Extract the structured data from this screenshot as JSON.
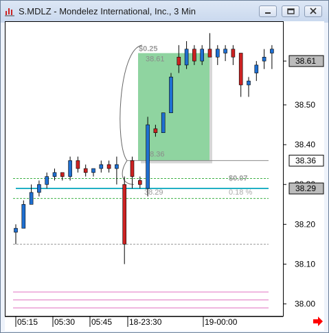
{
  "window": {
    "title": "S.MDLZ - Mondelez International, Inc., 3 Min",
    "icon": "chart-app-icon",
    "controls": [
      "minimize-icon",
      "maximize-icon",
      "close-icon"
    ]
  },
  "colors": {
    "up": "#1f6fd1",
    "down": "#cc2222",
    "hline_teal": "#20b0c4",
    "hline_green": "#3bb043",
    "hline_gray": "#999999",
    "hline_pink": "#e070c0",
    "box_fill": "#8fd4a0",
    "arrow": "#ff0000"
  },
  "chart_data": {
    "type": "candlestick",
    "ylim": [
      37.97,
      38.71
    ],
    "y_ticks": [
      "38.61",
      "38.50",
      "38.40",
      "38.30",
      "38.20",
      "38.10",
      "38.00"
    ],
    "price_labels": [
      {
        "text": "38.61",
        "value": 38.61,
        "style": "gray"
      },
      {
        "text": "38.36",
        "value": 38.36,
        "style": "white"
      },
      {
        "text": "38.29",
        "value": 38.29,
        "style": "gray"
      }
    ],
    "x_labels": [
      "05:15",
      "05:30",
      "05:45",
      "18-23:30",
      "19-00:00"
    ],
    "candles": [
      {
        "o": 38.18,
        "h": 38.2,
        "l": 38.15,
        "c": 38.19
      },
      {
        "o": 38.19,
        "h": 38.26,
        "l": 38.19,
        "c": 38.25
      },
      {
        "o": 38.25,
        "h": 38.3,
        "l": 38.25,
        "c": 38.28
      },
      {
        "o": 38.28,
        "h": 38.31,
        "l": 38.27,
        "c": 38.3
      },
      {
        "o": 38.3,
        "h": 38.33,
        "l": 38.29,
        "c": 38.32
      },
      {
        "o": 38.32,
        "h": 38.34,
        "l": 38.31,
        "c": 38.33
      },
      {
        "o": 38.33,
        "h": 38.33,
        "l": 38.31,
        "c": 38.32
      },
      {
        "o": 38.32,
        "h": 38.37,
        "l": 38.31,
        "c": 38.36
      },
      {
        "o": 38.36,
        "h": 38.37,
        "l": 38.33,
        "c": 38.34
      },
      {
        "o": 38.34,
        "h": 38.35,
        "l": 38.32,
        "c": 38.33
      },
      {
        "o": 38.33,
        "h": 38.34,
        "l": 38.32,
        "c": 38.34
      },
      {
        "o": 38.34,
        "h": 38.36,
        "l": 38.33,
        "c": 38.35
      },
      {
        "o": 38.35,
        "h": 38.36,
        "l": 38.33,
        "c": 38.34
      },
      {
        "o": 38.34,
        "h": 38.37,
        "l": 38.3,
        "c": 38.35
      },
      {
        "o": 38.3,
        "h": 38.32,
        "l": 38.1,
        "c": 38.15
      },
      {
        "o": 38.36,
        "h": 38.37,
        "l": 38.29,
        "c": 38.32
      },
      {
        "o": 38.31,
        "h": 38.32,
        "l": 38.29,
        "c": 38.3
      },
      {
        "o": 38.29,
        "h": 38.47,
        "l": 38.27,
        "c": 38.45
      },
      {
        "o": 38.44,
        "h": 38.45,
        "l": 38.42,
        "c": 38.43
      },
      {
        "o": 38.43,
        "h": 38.48,
        "l": 38.43,
        "c": 38.48
      },
      {
        "o": 38.48,
        "h": 38.58,
        "l": 38.48,
        "c": 38.57
      },
      {
        "o": 38.62,
        "h": 38.65,
        "l": 38.58,
        "c": 38.6
      },
      {
        "o": 38.6,
        "h": 38.66,
        "l": 38.59,
        "c": 38.64
      },
      {
        "o": 38.64,
        "h": 38.65,
        "l": 38.6,
        "c": 38.61
      },
      {
        "o": 38.61,
        "h": 38.65,
        "l": 38.6,
        "c": 38.64
      },
      {
        "o": 38.64,
        "h": 38.68,
        "l": 38.62,
        "c": 38.62
      },
      {
        "o": 38.62,
        "h": 38.65,
        "l": 38.6,
        "c": 38.64
      },
      {
        "o": 38.63,
        "h": 38.65,
        "l": 38.61,
        "c": 38.64
      },
      {
        "o": 38.64,
        "h": 38.65,
        "l": 38.6,
        "c": 38.62
      },
      {
        "o": 38.63,
        "h": 38.63,
        "l": 38.52,
        "c": 38.55
      },
      {
        "o": 38.55,
        "h": 38.57,
        "l": 38.52,
        "c": 38.56
      },
      {
        "o": 38.58,
        "h": 38.61,
        "l": 38.56,
        "c": 38.6
      },
      {
        "o": 38.61,
        "h": 38.64,
        "l": 38.59,
        "c": 38.62
      },
      {
        "o": 38.63,
        "h": 38.65,
        "l": 38.59,
        "c": 38.64
      }
    ],
    "horizontal_lines": [
      {
        "value": 38.36,
        "style": "gray-solid"
      },
      {
        "value": 38.315,
        "style": "green-dash"
      },
      {
        "value": 38.29,
        "style": "teal"
      },
      {
        "value": 38.265,
        "style": "green-dash"
      },
      {
        "value": 38.15,
        "style": "gray-dash"
      },
      {
        "value": 38.03,
        "style": "pink"
      },
      {
        "value": 38.01,
        "style": "pink"
      },
      {
        "value": 37.99,
        "style": "pink"
      }
    ],
    "trade_box": {
      "top": 38.63,
      "bottom": 38.36,
      "profit_label": "$0.25",
      "entry_label": "38.61",
      "exit_label": "38.36"
    },
    "trade_info": {
      "entry_text": "38.29",
      "pnl_text": "$0.07",
      "pct_text": "0.18 %"
    },
    "grid": false,
    "legend": "none"
  }
}
